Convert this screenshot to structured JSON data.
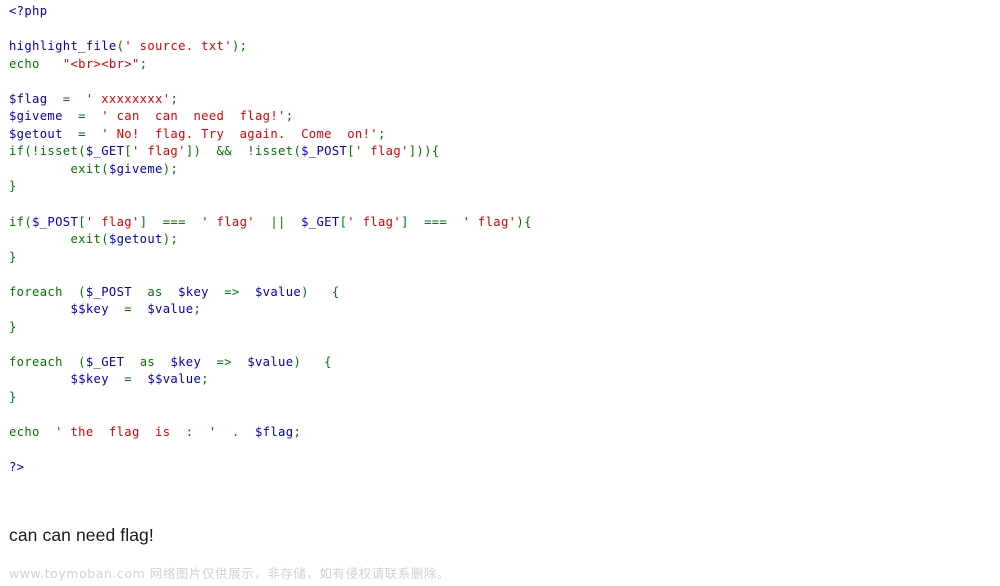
{
  "document": {
    "type": "php-source-listing",
    "background_color": "#ffffff",
    "syntax_colors": {
      "keyword": "#007700",
      "string": "#DD0000",
      "variable": "#0000BB",
      "php_tag": "#0000BB",
      "default_text": "#000000",
      "output_text": "#1b1b1b",
      "watermark": "#d2d2d2"
    }
  },
  "source": {
    "language": "PHP",
    "lines": [
      {
        "id": "line-1",
        "indent": 0,
        "tokens": [
          {
            "t": "<?php",
            "c": "d"
          }
        ]
      },
      {
        "id": "line-2",
        "indent": 0,
        "tokens": []
      },
      {
        "id": "line-3",
        "indent": 0,
        "tokens": [
          {
            "t": "highlight_file",
            "c": "v"
          },
          {
            "t": "(",
            "c": "k"
          },
          {
            "t": "' source. txt'",
            "c": "s"
          },
          {
            "t": ")",
            "c": "k"
          },
          {
            "t": ";",
            "c": "k"
          }
        ]
      },
      {
        "id": "line-4",
        "indent": 0,
        "tokens": [
          {
            "t": "echo",
            "c": "k"
          },
          {
            "t": "   ",
            "c": "k"
          },
          {
            "t": "\"<br><br>\"",
            "c": "s"
          },
          {
            "t": ";",
            "c": "k"
          }
        ]
      },
      {
        "id": "line-5",
        "indent": 0,
        "tokens": []
      },
      {
        "id": "line-6",
        "indent": 0,
        "tokens": [
          {
            "t": "$flag",
            "c": "v"
          },
          {
            "t": "  =  ",
            "c": "k"
          },
          {
            "t": "' xxxxxxxx'",
            "c": "s"
          },
          {
            "t": ";",
            "c": "k"
          }
        ]
      },
      {
        "id": "line-7",
        "indent": 0,
        "tokens": [
          {
            "t": "$giveme",
            "c": "v"
          },
          {
            "t": "  =  ",
            "c": "k"
          },
          {
            "t": "' can  can  need  flag!'",
            "c": "s"
          },
          {
            "t": ";",
            "c": "k"
          }
        ]
      },
      {
        "id": "line-8",
        "indent": 0,
        "tokens": [
          {
            "t": "$getout",
            "c": "v"
          },
          {
            "t": "  =  ",
            "c": "k"
          },
          {
            "t": "' No!  flag. Try  again.  Come  on!'",
            "c": "s"
          },
          {
            "t": ";",
            "c": "k"
          }
        ]
      },
      {
        "id": "line-9",
        "indent": 0,
        "tokens": [
          {
            "t": "if",
            "c": "k"
          },
          {
            "t": "(!",
            "c": "k"
          },
          {
            "t": "isset",
            "c": "k"
          },
          {
            "t": "(",
            "c": "k"
          },
          {
            "t": "$_GET",
            "c": "v"
          },
          {
            "t": "[",
            "c": "k"
          },
          {
            "t": "' flag'",
            "c": "s"
          },
          {
            "t": "])",
            "c": "k"
          },
          {
            "t": "  &&  !",
            "c": "k"
          },
          {
            "t": "isset",
            "c": "k"
          },
          {
            "t": "(",
            "c": "k"
          },
          {
            "t": "$_POST",
            "c": "v"
          },
          {
            "t": "[",
            "c": "k"
          },
          {
            "t": "' flag'",
            "c": "s"
          },
          {
            "t": "]))",
            "c": "k"
          },
          {
            "t": "{",
            "c": "k"
          }
        ]
      },
      {
        "id": "line-10",
        "indent": 0,
        "tokens": [
          {
            "t": "        ",
            "c": "k"
          },
          {
            "t": "exit",
            "c": "k"
          },
          {
            "t": "(",
            "c": "k"
          },
          {
            "t": "$giveme",
            "c": "v"
          },
          {
            "t": ")",
            "c": "k"
          },
          {
            "t": ";",
            "c": "k"
          }
        ]
      },
      {
        "id": "line-11",
        "indent": 0,
        "tokens": [
          {
            "t": "}",
            "c": "k"
          }
        ]
      },
      {
        "id": "line-12",
        "indent": 0,
        "tokens": []
      },
      {
        "id": "line-13",
        "indent": 0,
        "tokens": [
          {
            "t": "if",
            "c": "k"
          },
          {
            "t": "(",
            "c": "k"
          },
          {
            "t": "$_POST",
            "c": "v"
          },
          {
            "t": "[",
            "c": "k"
          },
          {
            "t": "' flag'",
            "c": "s"
          },
          {
            "t": "]",
            "c": "k"
          },
          {
            "t": "  ===  ",
            "c": "k"
          },
          {
            "t": "' flag'",
            "c": "s"
          },
          {
            "t": "  ||  ",
            "c": "k"
          },
          {
            "t": "$_GET",
            "c": "v"
          },
          {
            "t": "[",
            "c": "k"
          },
          {
            "t": "' flag'",
            "c": "s"
          },
          {
            "t": "]",
            "c": "k"
          },
          {
            "t": "  ===  ",
            "c": "k"
          },
          {
            "t": "' flag'",
            "c": "s"
          },
          {
            "t": ")",
            "c": "k"
          },
          {
            "t": "{",
            "c": "k"
          }
        ]
      },
      {
        "id": "line-14",
        "indent": 0,
        "tokens": [
          {
            "t": "        ",
            "c": "k"
          },
          {
            "t": "exit",
            "c": "k"
          },
          {
            "t": "(",
            "c": "k"
          },
          {
            "t": "$getout",
            "c": "v"
          },
          {
            "t": ")",
            "c": "k"
          },
          {
            "t": ";",
            "c": "k"
          }
        ]
      },
      {
        "id": "line-15",
        "indent": 0,
        "tokens": [
          {
            "t": "}",
            "c": "k"
          }
        ]
      },
      {
        "id": "line-16",
        "indent": 0,
        "tokens": []
      },
      {
        "id": "line-17",
        "indent": 0,
        "tokens": [
          {
            "t": "foreach",
            "c": "k"
          },
          {
            "t": "  (",
            "c": "k"
          },
          {
            "t": "$_POST",
            "c": "v"
          },
          {
            "t": "  ",
            "c": "k"
          },
          {
            "t": "as",
            "c": "k"
          },
          {
            "t": "  ",
            "c": "k"
          },
          {
            "t": "$key",
            "c": "v"
          },
          {
            "t": "  =>  ",
            "c": "k"
          },
          {
            "t": "$value",
            "c": "v"
          },
          {
            "t": ")",
            "c": "k"
          },
          {
            "t": "   {",
            "c": "k"
          }
        ]
      },
      {
        "id": "line-18",
        "indent": 0,
        "tokens": [
          {
            "t": "        ",
            "c": "k"
          },
          {
            "t": "$",
            "c": "v"
          },
          {
            "t": "$key",
            "c": "v"
          },
          {
            "t": "  =  ",
            "c": "k"
          },
          {
            "t": "$value",
            "c": "v"
          },
          {
            "t": ";",
            "c": "k"
          }
        ]
      },
      {
        "id": "line-19",
        "indent": 0,
        "tokens": [
          {
            "t": "}",
            "c": "k"
          }
        ]
      },
      {
        "id": "line-20",
        "indent": 0,
        "tokens": []
      },
      {
        "id": "line-21",
        "indent": 0,
        "tokens": [
          {
            "t": "foreach",
            "c": "k"
          },
          {
            "t": "  (",
            "c": "k"
          },
          {
            "t": "$_GET",
            "c": "v"
          },
          {
            "t": "  ",
            "c": "k"
          },
          {
            "t": "as",
            "c": "k"
          },
          {
            "t": "  ",
            "c": "k"
          },
          {
            "t": "$key",
            "c": "v"
          },
          {
            "t": "  =>  ",
            "c": "k"
          },
          {
            "t": "$value",
            "c": "v"
          },
          {
            "t": ")",
            "c": "k"
          },
          {
            "t": "   {",
            "c": "k"
          }
        ]
      },
      {
        "id": "line-22",
        "indent": 0,
        "tokens": [
          {
            "t": "        ",
            "c": "k"
          },
          {
            "t": "$",
            "c": "v"
          },
          {
            "t": "$key",
            "c": "v"
          },
          {
            "t": "  =  ",
            "c": "k"
          },
          {
            "t": "$",
            "c": "v"
          },
          {
            "t": "$value",
            "c": "v"
          },
          {
            "t": ";",
            "c": "k"
          }
        ]
      },
      {
        "id": "line-23",
        "indent": 0,
        "tokens": [
          {
            "t": "}",
            "c": "k"
          }
        ]
      },
      {
        "id": "line-24",
        "indent": 0,
        "tokens": []
      },
      {
        "id": "line-25",
        "indent": 0,
        "tokens": [
          {
            "t": "echo",
            "c": "k"
          },
          {
            "t": "  ",
            "c": "k"
          },
          {
            "t": "' the  flag  is  :  '",
            "c": "s"
          },
          {
            "t": "  .  ",
            "c": "k"
          },
          {
            "t": "$flag",
            "c": "v"
          },
          {
            "t": ";",
            "c": "k"
          }
        ]
      },
      {
        "id": "line-26",
        "indent": 0,
        "tokens": []
      },
      {
        "id": "line-27",
        "indent": 0,
        "tokens": [
          {
            "t": "?>",
            "c": "d"
          }
        ]
      }
    ]
  },
  "output": {
    "message": "can can need flag!"
  },
  "watermark": {
    "text": "www.toymoban.com 网络图片仅供展示，非存储，如有侵权请联系删除。"
  }
}
